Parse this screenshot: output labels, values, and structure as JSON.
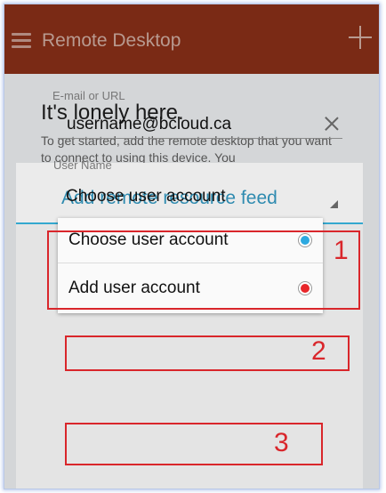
{
  "app_bar": {
    "title": "Remote Desktop"
  },
  "empty_state": {
    "heading": "It's lonely here.",
    "text": "To get started, add the remote desktop that you want to connect to using this device. You"
  },
  "dialog": {
    "title": "Add remote resource feed",
    "email_label": "E-mail or URL",
    "email_value": "username@bcloud.ca",
    "username_label": "User Name",
    "selected_account": "Choose user account",
    "options": [
      {
        "label": "Choose user account",
        "state": "selected"
      },
      {
        "label": "Add user account",
        "state": "highlighted"
      }
    ]
  },
  "annotations": {
    "one": "1",
    "two": "2",
    "three": "3"
  },
  "colors": {
    "app_bar": "#7a2a15",
    "dialog_accent": "#34a8cf",
    "annotation": "#d9262b",
    "radio_selected": "#2da9e0",
    "radio_red": "#e8262a"
  }
}
